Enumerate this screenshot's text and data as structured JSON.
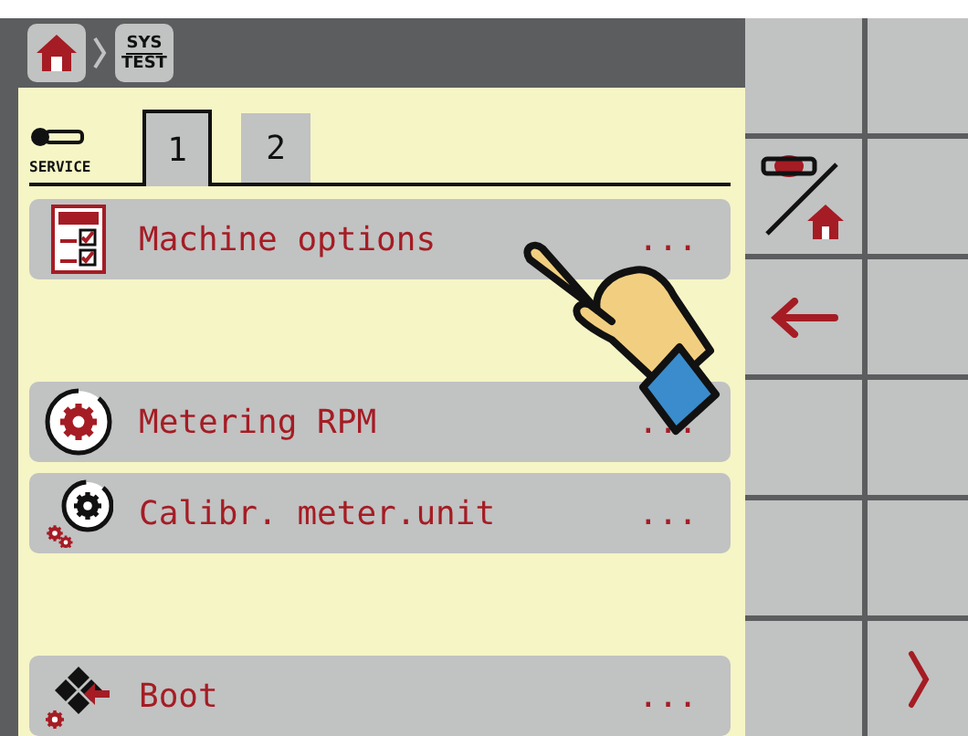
{
  "breadcrumb": {
    "current": {
      "line1": "SYS",
      "line2": "TEST"
    }
  },
  "access": {
    "label": "SERVICE"
  },
  "tabs": [
    {
      "label": "1",
      "selected": true
    },
    {
      "label": "2",
      "selected": false
    }
  ],
  "menu": [
    {
      "kind": "options",
      "label": "Machine options",
      "more": "..."
    },
    {
      "kind": "empty"
    },
    {
      "kind": "rpm",
      "label": "Metering RPM",
      "more": "..."
    },
    {
      "kind": "calibrate",
      "label": "Calibr. meter.unit",
      "more": "..."
    },
    {
      "kind": "empty"
    },
    {
      "kind": "boot",
      "label": "Boot",
      "more": "..."
    }
  ],
  "softkeys": [
    {
      "kind": "blank"
    },
    {
      "kind": "blank"
    },
    {
      "kind": "switch"
    },
    {
      "kind": "blank"
    },
    {
      "kind": "back"
    },
    {
      "kind": "blank"
    },
    {
      "kind": "blank"
    },
    {
      "kind": "blank"
    },
    {
      "kind": "blank"
    },
    {
      "kind": "blank"
    },
    {
      "kind": "blank"
    },
    {
      "kind": "next"
    }
  ]
}
